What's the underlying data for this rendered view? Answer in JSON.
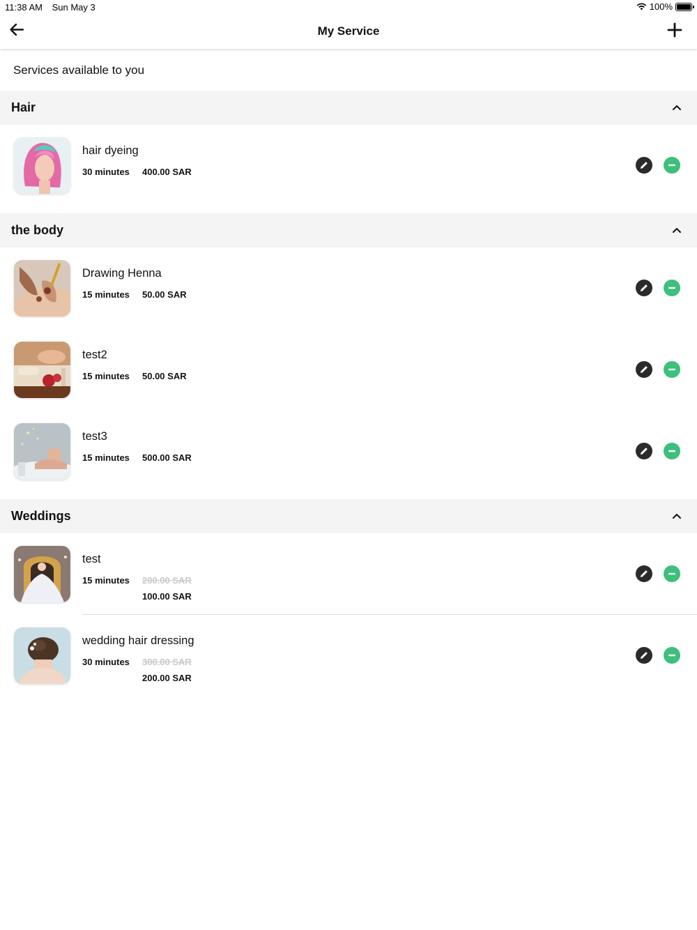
{
  "status_bar": {
    "time": "11:38 AM",
    "date": "Sun May 3",
    "battery": "100%",
    "battery_level": 1.0
  },
  "nav": {
    "title": "My Service",
    "back_icon": "arrow-left-icon",
    "add_icon": "plus-icon"
  },
  "intro": "Services available to you",
  "sections": [
    {
      "title": "Hair",
      "services": [
        {
          "name": "hair dyeing",
          "duration": "30 minutes",
          "price": "400.00 SAR"
        }
      ]
    },
    {
      "title": "the body",
      "services": [
        {
          "name": "Drawing Henna",
          "duration": "15 minutes",
          "price": "50.00 SAR"
        },
        {
          "name": "test2",
          "duration": "15 minutes",
          "price": "50.00 SAR"
        },
        {
          "name": "test3",
          "duration": "15 minutes",
          "price": "500.00 SAR"
        }
      ]
    },
    {
      "title": "Weddings",
      "services": [
        {
          "name": "test",
          "duration": "15 minutes",
          "old_price": "200.00 SAR",
          "price": "100.00 SAR"
        },
        {
          "name": "wedding hair dressing",
          "duration": "30 minutes",
          "old_price": "300.00 SAR",
          "price": "200.00 SAR"
        }
      ]
    }
  ],
  "colors": {
    "section_bg": "#f4f4f4",
    "edit_button": "#2b2b2b",
    "remove_button": "#3cc07a",
    "old_price": "#c8c8c8"
  }
}
